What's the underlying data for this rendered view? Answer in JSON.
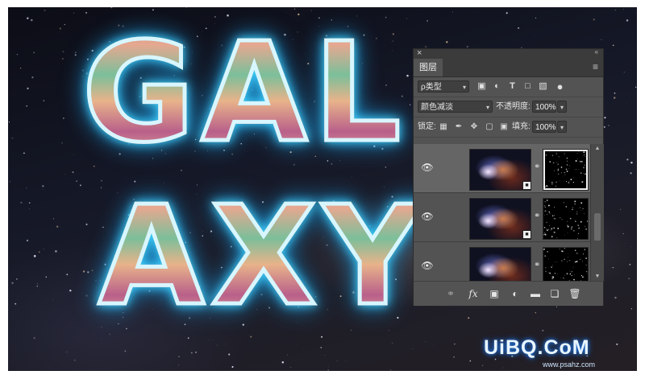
{
  "artwork": {
    "line1": "GAL",
    "line2": "AXY",
    "glow_color": "#43d6ff"
  },
  "layers_panel": {
    "close_glyph": "×",
    "collapse_glyph": "«",
    "tab_label": "图层",
    "menu_icon": "panel-menu-icon",
    "filter": {
      "kind_label": "ρ类型",
      "icons": [
        "image-filter-icon",
        "adjustment-filter-icon",
        "type-filter-icon",
        "shape-filter-icon",
        "smart-object-filter-icon",
        "filter-toggle-icon"
      ]
    },
    "blend_mode": "颜色减淡",
    "opacity_label": "不透明度:",
    "opacity_value": "100%",
    "lock_label": "锁定:",
    "lock_icons": [
      "lock-transparent-icon",
      "lock-paint-icon",
      "lock-position-icon",
      "lock-artboard-icon",
      "lock-all-icon"
    ],
    "fill_label": "填充:",
    "fill_value": "100%",
    "layers": [
      {
        "visible": true,
        "selected": true
      },
      {
        "visible": true,
        "selected": false
      },
      {
        "visible": true,
        "selected": false
      }
    ],
    "bottom_icons": [
      "link-layers-icon",
      "fx-icon",
      "add-mask-icon",
      "new-adjustment-icon",
      "new-group-icon",
      "new-layer-icon",
      "delete-layer-icon"
    ],
    "fx_text": "fx"
  },
  "watermark": {
    "logo": "UiBQ.CoM",
    "url": "www.psahz.com"
  }
}
